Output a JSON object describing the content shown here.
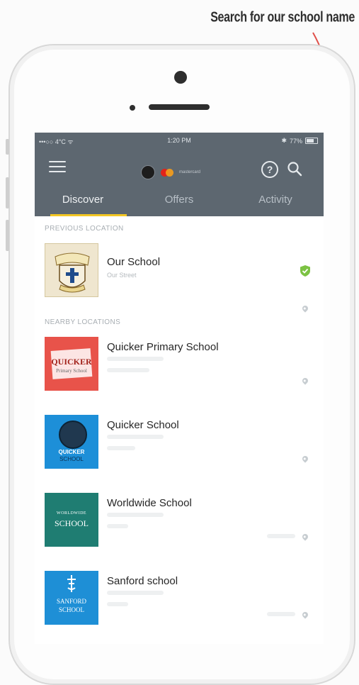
{
  "annotation": {
    "text": "Search for our school name"
  },
  "status_bar": {
    "carrier": "•••○○ 4°C ᯤ",
    "time": "1:20 PM",
    "battery": "77%"
  },
  "header": {
    "menu_icon": "hamburger-icon",
    "help_icon": "question-circle-icon",
    "help_glyph": "?",
    "search_icon": "search-icon",
    "brand_text": "mastercard"
  },
  "tabs": [
    {
      "label": "Discover",
      "active": true
    },
    {
      "label": "Offers",
      "active": false
    },
    {
      "label": "Activity",
      "active": false
    }
  ],
  "previous": {
    "section_label": "PREVIOUS LOCATION",
    "item": {
      "name": "Our School",
      "subtitle": "Our Street"
    }
  },
  "nearby": {
    "section_label": "NEARBY LOCATIONS",
    "items": [
      {
        "name": "Quicker Primary School",
        "logo_text": "QUICKER",
        "logo_sub": "Primary School"
      },
      {
        "name": "Quicker School",
        "logo_text": "QUICKER",
        "logo_sub": "SCHOOL"
      },
      {
        "name": "Worldwide School",
        "logo_text": "WORLDWIDE",
        "logo_sub": "SCHOOL"
      },
      {
        "name": "Sanford school",
        "logo_text": "SANFORD",
        "logo_sub": "SCHOOL"
      }
    ]
  },
  "colors": {
    "header_bg": "#5d6770",
    "tab_indicator": "#f3c623",
    "verified_green": "#7cc243"
  }
}
